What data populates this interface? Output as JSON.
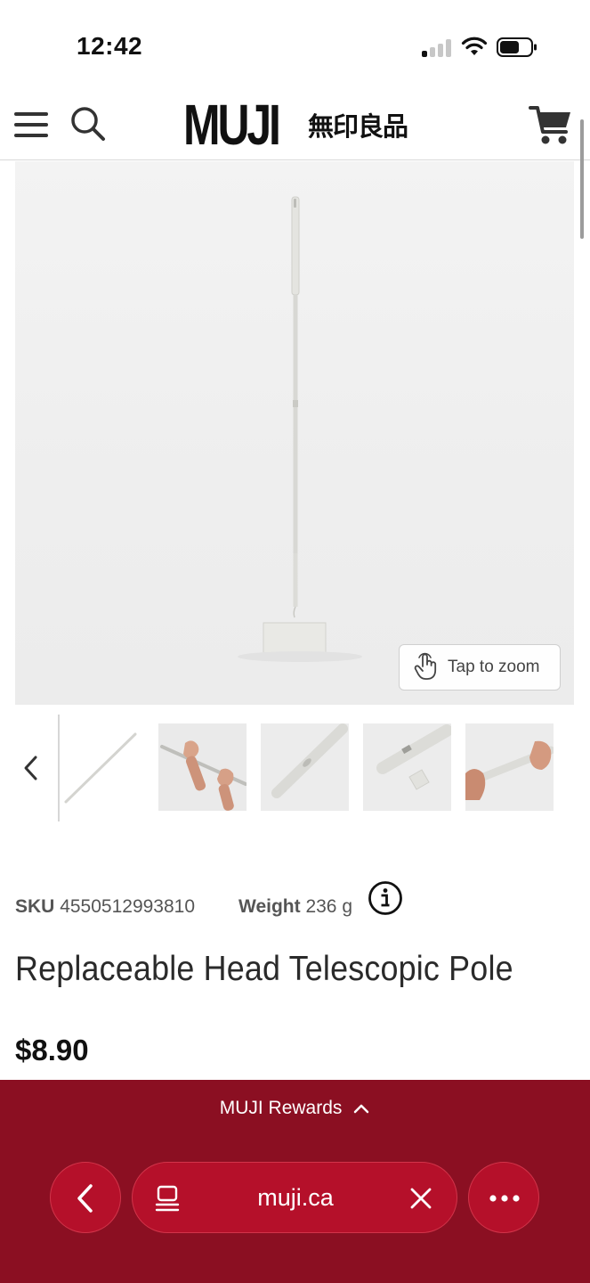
{
  "status_bar": {
    "time": "12:42",
    "signal_bars_active": 1,
    "battery_level": 0.6
  },
  "header": {
    "logo_latin": "MUJI",
    "logo_kanji": "無印良品",
    "menu_icon": "hamburger-icon",
    "search_icon": "search-icon",
    "cart_icon": "cart-icon"
  },
  "product": {
    "image_alt": "Replaceable Head Telescopic Pole",
    "zoom_label": "Tap to zoom",
    "thumbnails": [
      {
        "name": "thumbnail-pole-full"
      },
      {
        "name": "thumbnail-hands-extending"
      },
      {
        "name": "thumbnail-pole-closeup"
      },
      {
        "name": "thumbnail-pole-parts"
      },
      {
        "name": "thumbnail-hand-attaching"
      }
    ],
    "sku_label": "SKU",
    "sku_value": "4550512993810",
    "weight_label": "Weight",
    "weight_value": "236 g",
    "title": "Replaceable Head Telescopic Pole",
    "price": "$8.90"
  },
  "browser": {
    "rewards_label": "MUJI Rewards",
    "url": "muji.ca",
    "accent": "#8b0f22",
    "button_color": "#b5102a"
  }
}
